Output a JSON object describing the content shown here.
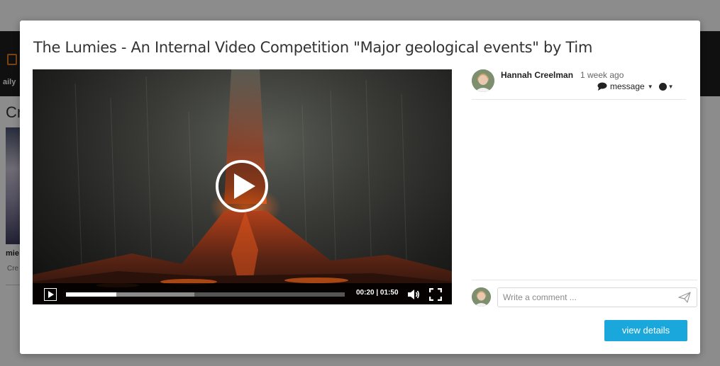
{
  "background": {
    "nav_text": "aily",
    "heading_fragment": "Cr",
    "card_title_fragment": "mie",
    "card_sub_fragment": "Cre"
  },
  "modal": {
    "title": "The Lumies - An Internal Video Competition \"Major geological events\" by Tim"
  },
  "video": {
    "current_time": "00:20",
    "duration": "01:50",
    "time_display": "00:20 | 01:50",
    "progress_fraction": 0.18,
    "buffered_fraction": 0.46
  },
  "author": {
    "name": "Hannah Creelman",
    "time_ago": "1 week ago",
    "message_label": "message"
  },
  "comment": {
    "placeholder": "Write a comment ..."
  },
  "actions": {
    "view_details_label": "view details"
  },
  "colors": {
    "accent": "#1aa7dc",
    "nav_bg": "#1e1e1e",
    "nav_icon": "#e07a1f"
  }
}
